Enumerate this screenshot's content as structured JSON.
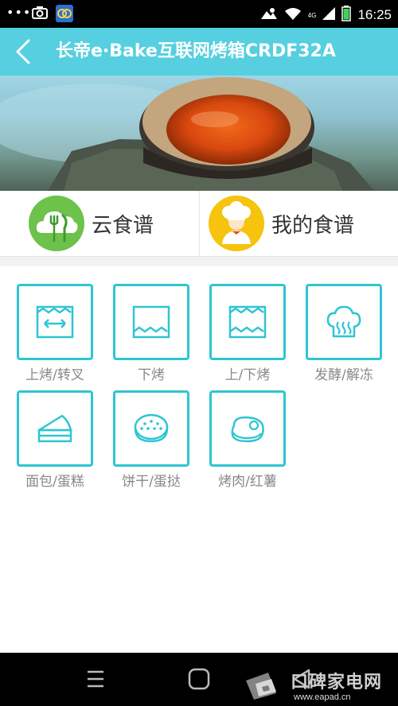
{
  "status_bar": {
    "dots": "•••",
    "network": "4G",
    "time": "16:25"
  },
  "header": {
    "title": "长帝e·Bake互联网烤箱CRDF32A"
  },
  "recipes": [
    {
      "label": "云食谱",
      "icon": "cloud-cutlery-icon",
      "color": "#6cc24a"
    },
    {
      "label": "我的食谱",
      "icon": "chef-icon",
      "color": "#f6c30e"
    }
  ],
  "modes": [
    {
      "label": "上烤/转叉",
      "icon": "top-bake-rotisserie-icon"
    },
    {
      "label": "下烤",
      "icon": "bottom-bake-icon"
    },
    {
      "label": "上/下烤",
      "icon": "top-bottom-bake-icon"
    },
    {
      "label": "发酵/解冻",
      "icon": "ferment-defrost-icon"
    },
    {
      "label": "面包/蛋糕",
      "icon": "cake-icon"
    },
    {
      "label": "饼干/蛋挞",
      "icon": "cookie-icon"
    },
    {
      "label": "烤肉/红薯",
      "icon": "meat-icon"
    }
  ],
  "watermark": {
    "title": "口碑家电网",
    "url": "www.eapad.cn"
  },
  "colors": {
    "header_bg": "#56cfe0",
    "accent": "#2ec5d3"
  }
}
